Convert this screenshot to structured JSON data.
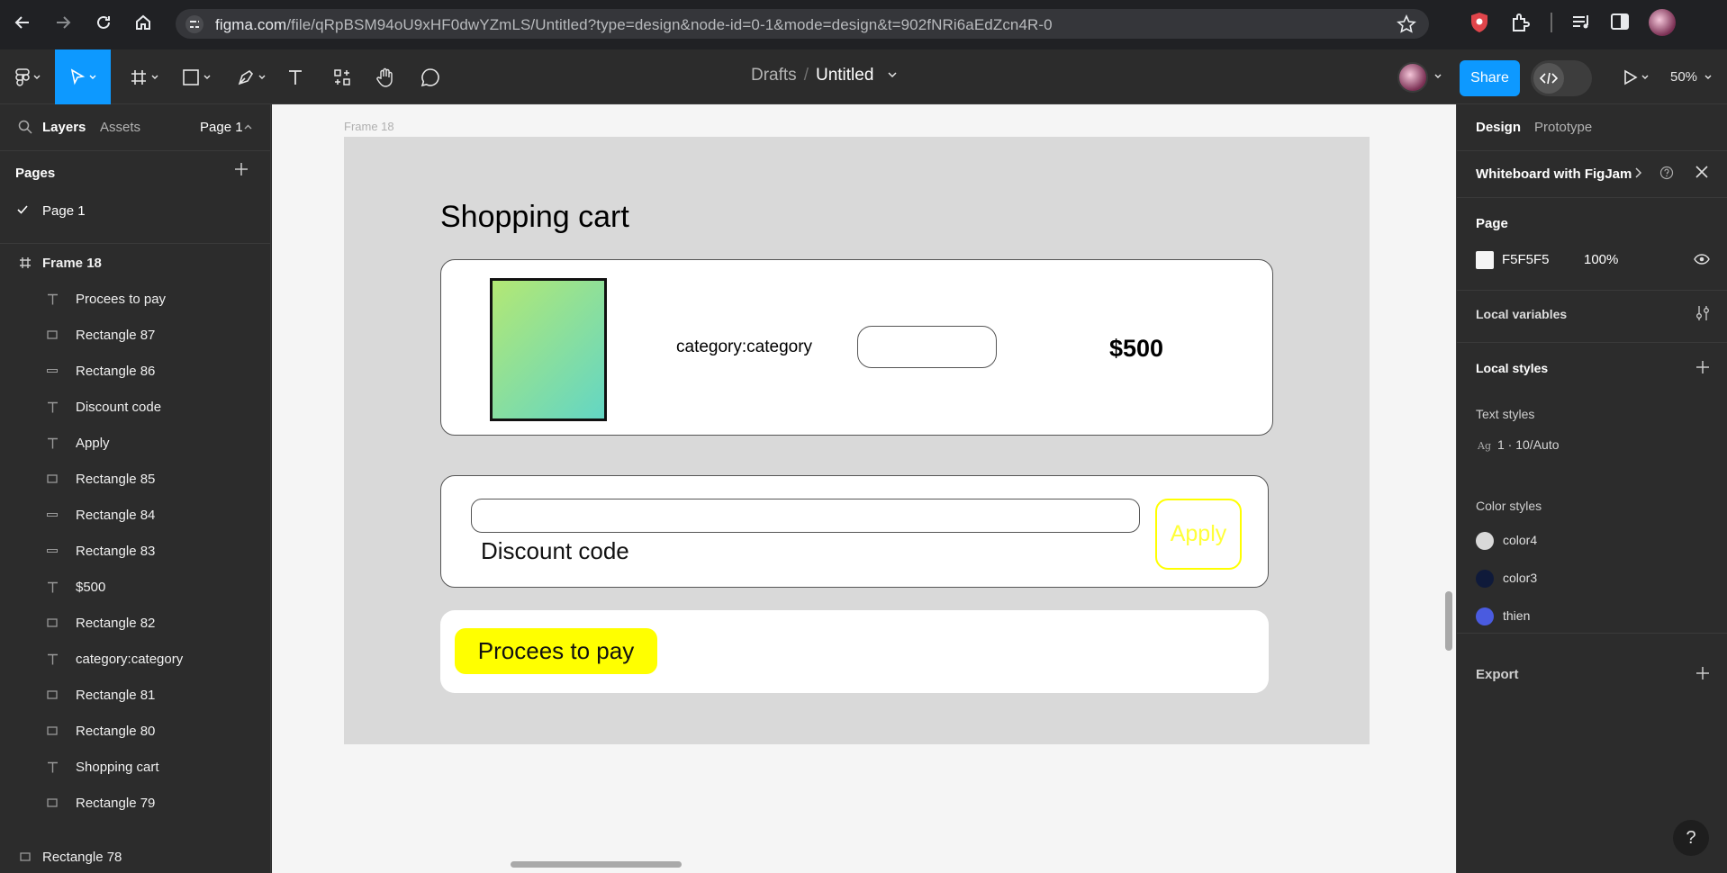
{
  "browser": {
    "url_host": "figma.com",
    "url_path": "/file/qRpBSM94oU9xHF0dwYZmLS/Untitled?type=design&node-id=0-1&mode=design&t=902fNRi6aEdZcn4R-0"
  },
  "toolbar": {
    "breadcrumb_drafts": "Drafts",
    "breadcrumb_slash": "/",
    "file_name": "Untitled",
    "share_label": "Share",
    "zoom": "50%"
  },
  "left_panel": {
    "tabs": {
      "layers": "Layers",
      "assets": "Assets",
      "page_select": "Page 1"
    },
    "pages_header": "Pages",
    "current_page": "Page 1",
    "frame_name": "Frame 18",
    "layers": [
      {
        "name": "Procees to pay",
        "icon": "text-icon"
      },
      {
        "name": "Rectangle 87",
        "icon": "rect-icon"
      },
      {
        "name": "Rectangle 86",
        "icon": "line-icon"
      },
      {
        "name": "Discount code",
        "icon": "text-icon"
      },
      {
        "name": "Apply",
        "icon": "text-icon"
      },
      {
        "name": "Rectangle 85",
        "icon": "rect-icon"
      },
      {
        "name": "Rectangle 84",
        "icon": "line-icon"
      },
      {
        "name": "Rectangle 83",
        "icon": "line-icon"
      },
      {
        "name": "$500",
        "icon": "text-icon"
      },
      {
        "name": "Rectangle 82",
        "icon": "rect-icon"
      },
      {
        "name": "category:category",
        "icon": "text-icon"
      },
      {
        "name": "Rectangle 81",
        "icon": "rect-icon"
      },
      {
        "name": "Rectangle 80",
        "icon": "rect-icon"
      },
      {
        "name": "Shopping cart",
        "icon": "text-icon"
      },
      {
        "name": "Rectangle 79",
        "icon": "rect-icon"
      }
    ],
    "bottom_layer": "Rectangle 78"
  },
  "canvas": {
    "frame_label": "Frame 18",
    "title": "Shopping cart",
    "category": "category:category",
    "price": "$500",
    "discount_label": "Discount code",
    "apply_label": "Apply",
    "pay_label": "Procees to pay"
  },
  "right_panel": {
    "tabs": {
      "design": "Design",
      "prototype": "Prototype"
    },
    "whiteboard": "Whiteboard with FigJam",
    "page_header": "Page",
    "page_color": "F5F5F5",
    "page_opacity": "100%",
    "local_variables": "Local variables",
    "local_styles": "Local styles",
    "text_styles_header": "Text styles",
    "text_style": "1 · 10/Auto",
    "color_styles_header": "Color styles",
    "color_styles": [
      {
        "name": "color4",
        "color": "#d9d9d9"
      },
      {
        "name": "color3",
        "color": "#0f1a3a"
      },
      {
        "name": "thien",
        "color": "#4a5be0"
      }
    ],
    "export": "Export"
  },
  "help": "?"
}
